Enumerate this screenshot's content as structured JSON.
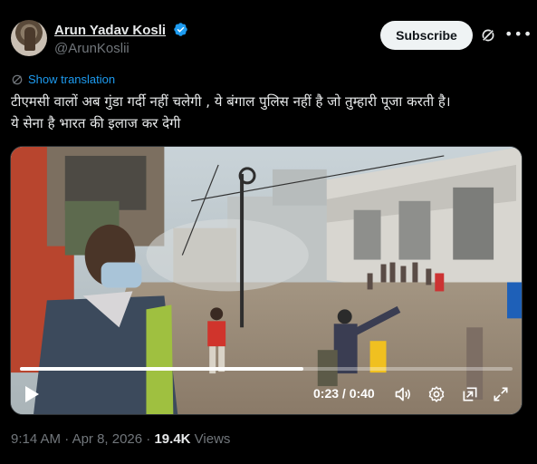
{
  "author": {
    "display_name": "Arun Yadav Kosli",
    "handle": "@ArunKoslii"
  },
  "actions": {
    "subscribe_label": "Subscribe"
  },
  "translation": {
    "label": "Show translation"
  },
  "post": {
    "text_line1": "टीएमसी वालों अब गुंडा गर्दी नहीं चलेगी , ये बंगाल पुलिस नहीं है जो तुम्हारी पूजा करती है।",
    "text_line2": "ये सेना है भारत की इलाज कर देगी"
  },
  "video": {
    "time_display": "0:23 / 0:40",
    "progress_fraction": 0.575
  },
  "meta": {
    "time": "9:14 AM",
    "separator": "·",
    "date": "Apr 8, 2026",
    "views_count": "19.4K",
    "views_label": "Views"
  },
  "colors": {
    "accent": "#1d9bf0",
    "background": "#000000",
    "text": "#e7e9ea",
    "muted": "#71767b"
  },
  "icons": [
    "verified-badge-icon",
    "grok-icon",
    "more-icon",
    "translate-icon",
    "play-icon",
    "volume-icon",
    "settings-icon",
    "picture-in-picture-icon",
    "fullscreen-icon"
  ]
}
